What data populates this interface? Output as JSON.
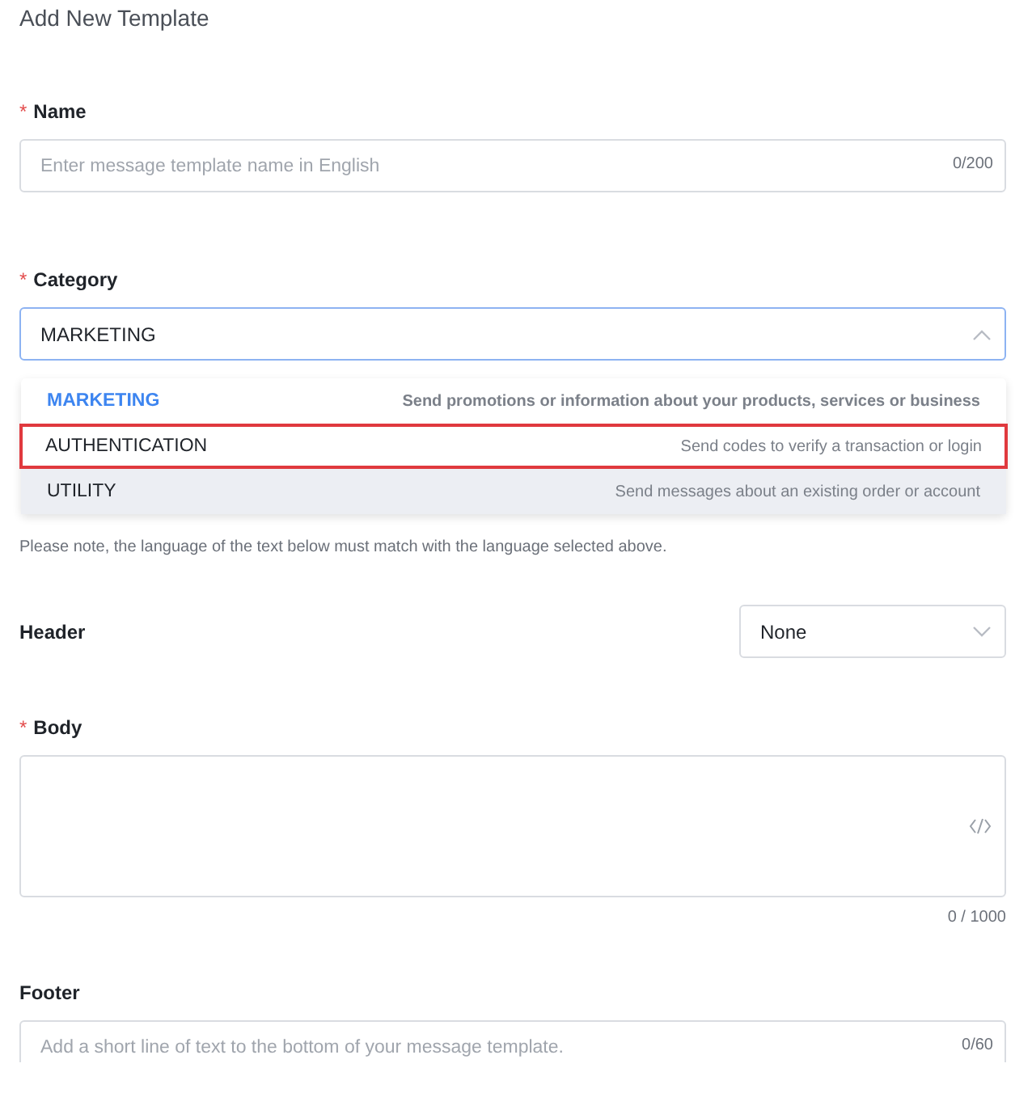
{
  "title": "Add New Template",
  "name": {
    "label": "Name",
    "marker": "*",
    "placeholder": "Enter message template name in English",
    "counter": "0/200"
  },
  "category": {
    "label": "Category",
    "marker": "*",
    "value": "MARKETING",
    "expanded": true,
    "options": [
      {
        "label": "MARKETING",
        "description": "Send promotions or information about your products, services or business",
        "selected": true,
        "hovered": false,
        "highlighted": false
      },
      {
        "label": "AUTHENTICATION",
        "description": "Send codes to verify a transaction or login",
        "selected": false,
        "hovered": false,
        "highlighted": true
      },
      {
        "label": "UTILITY",
        "description": "Send messages about an existing order or account",
        "selected": false,
        "hovered": true,
        "highlighted": false
      }
    ]
  },
  "note": "Please note, the language of the text below must match with the language selected above.",
  "header": {
    "label": "Header",
    "value": "None"
  },
  "body": {
    "label": "Body",
    "marker": "*",
    "counter": "0 / 1000"
  },
  "footer": {
    "label": "Footer",
    "placeholder": "Add a short line of text to the bottom of your message template.",
    "counter": "0/60"
  }
}
